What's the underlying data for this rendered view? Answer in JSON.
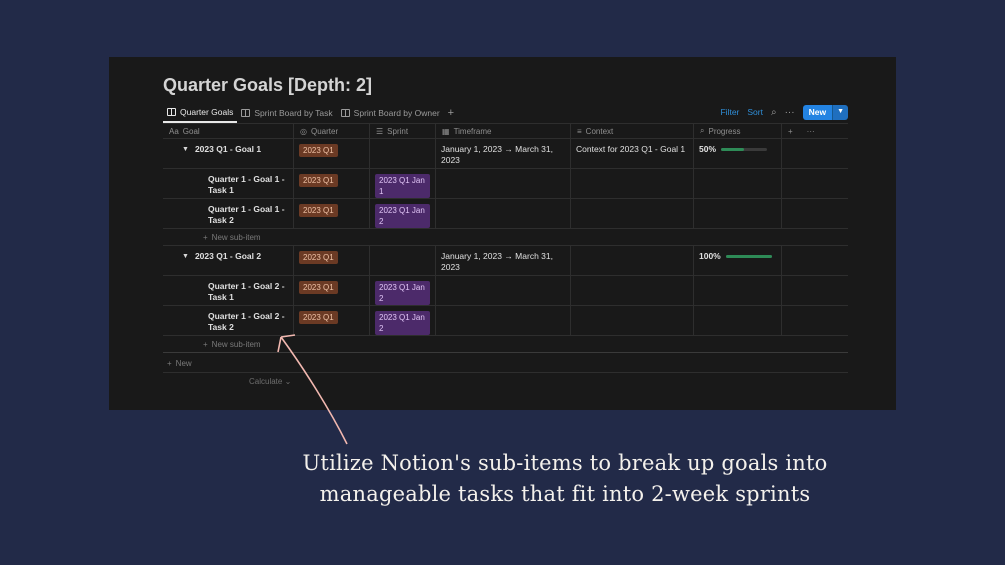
{
  "page": {
    "title": "Quarter Goals [Depth: 2]"
  },
  "views": [
    {
      "label": "Quarter Goals",
      "active": true
    },
    {
      "label": "Sprint Board by Task",
      "active": false
    },
    {
      "label": "Sprint Board by Owner",
      "active": false
    }
  ],
  "toolbar": {
    "filter": "Filter",
    "sort": "Sort",
    "new": "New"
  },
  "columns": {
    "goal": "Goal",
    "quarter": "Quarter",
    "sprint": "Sprint",
    "timeframe": "Timeframe",
    "context": "Context",
    "progress": "Progress"
  },
  "rows": [
    {
      "type": "goal",
      "name": "2023 Q1 - Goal 1",
      "quarter": "2023 Q1",
      "sprint": "",
      "timeframe": "January 1, 2023 → March 31, 2023",
      "context": "Context for 2023 Q1 - Goal 1",
      "progress": "50%",
      "progress_value": 0.5
    },
    {
      "type": "task",
      "name": "Quarter 1 - Goal 1 - Task 1",
      "quarter": "2023 Q1",
      "sprint": "2023 Q1 Jan 1"
    },
    {
      "type": "task",
      "name": "Quarter 1 - Goal 1 - Task 2",
      "quarter": "2023 Q1",
      "sprint": "2023 Q1 Jan 2"
    },
    {
      "type": "sub",
      "name": "New sub-item"
    },
    {
      "type": "goal",
      "name": "2023 Q1 - Goal 2",
      "quarter": "2023 Q1",
      "sprint": "",
      "timeframe": "January 1, 2023 → March 31, 2023",
      "context": "",
      "progress": "100%",
      "progress_value": 1.0
    },
    {
      "type": "task",
      "name": "Quarter 1 - Goal 2 - Task 1",
      "quarter": "2023 Q1",
      "sprint": "2023 Q1 Jan 2"
    },
    {
      "type": "task",
      "name": "Quarter 1 - Goal 2 - Task 2",
      "quarter": "2023 Q1",
      "sprint": "2023 Q1 Jan 2"
    },
    {
      "type": "sub",
      "name": "New sub-item"
    }
  ],
  "footer": {
    "new_label": "New",
    "calculate_label": "Calculate"
  },
  "caption": {
    "line1": "Utilize Notion's sub-items to break up goals into",
    "line2": "manageable tasks that fit into 2-week sprints"
  },
  "colors": {
    "background": "#222a48",
    "accent": "#2383e2",
    "quarter_badge": "#6b3a24",
    "sprint_badge": "#4c2a6a",
    "progress": "#2e8b57",
    "arrow": "#f2b8b0"
  }
}
